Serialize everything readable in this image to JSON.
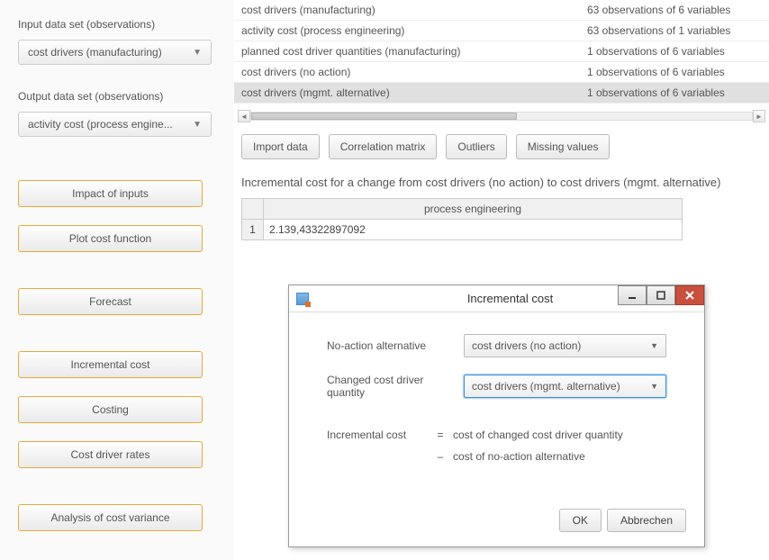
{
  "sidebar": {
    "input_label": "Input data set (observations)",
    "input_value": "cost drivers (manufacturing)",
    "output_label": "Output data set (observations)",
    "output_value": "activity cost (process engine...",
    "buttons": {
      "impact": "Impact of inputs",
      "plotcf": "Plot cost function",
      "forecast": "Forecast",
      "incremental": "Incremental cost",
      "costing": "Costing",
      "rates": "Cost driver rates",
      "variance": "Analysis of cost variance"
    }
  },
  "datasets": [
    {
      "name": "cost drivers (manufacturing)",
      "info": "63 observations of 6 variables",
      "sel": false
    },
    {
      "name": "activity cost (process engineering)",
      "info": "63 observations of 1 variables",
      "sel": false
    },
    {
      "name": "planned cost driver quantities (manufacturing)",
      "info": "1 observations of 6 variables",
      "sel": false
    },
    {
      "name": "cost drivers (no action)",
      "info": "1 observations of 6 variables",
      "sel": false
    },
    {
      "name": "cost drivers (mgmt. alternative)",
      "info": "1 observations of 6 variables",
      "sel": true
    }
  ],
  "toolbar": {
    "import": "Import data",
    "corr": "Correlation matrix",
    "outliers": "Outliers",
    "missing": "Missing values"
  },
  "result": {
    "heading": "Incremental cost for a change from cost drivers (no action) to cost drivers (mgmt. alternative)",
    "col_header": "process engineering",
    "rownum": "1",
    "value": "2.139,43322897092"
  },
  "modal": {
    "title": "Incremental cost",
    "noaction_label": "No-action alternative",
    "noaction_value": "cost drivers (no action)",
    "changed_label": "Changed cost driver quantity",
    "changed_value": "cost drivers (mgmt. alternative)",
    "eq_label": "Incremental cost",
    "eq_sign": "=",
    "eq_line1": "cost of changed cost driver quantity",
    "eq_minus": "–",
    "eq_line2": "cost of no-action alternative",
    "ok": "OK",
    "cancel": "Abbrechen"
  }
}
